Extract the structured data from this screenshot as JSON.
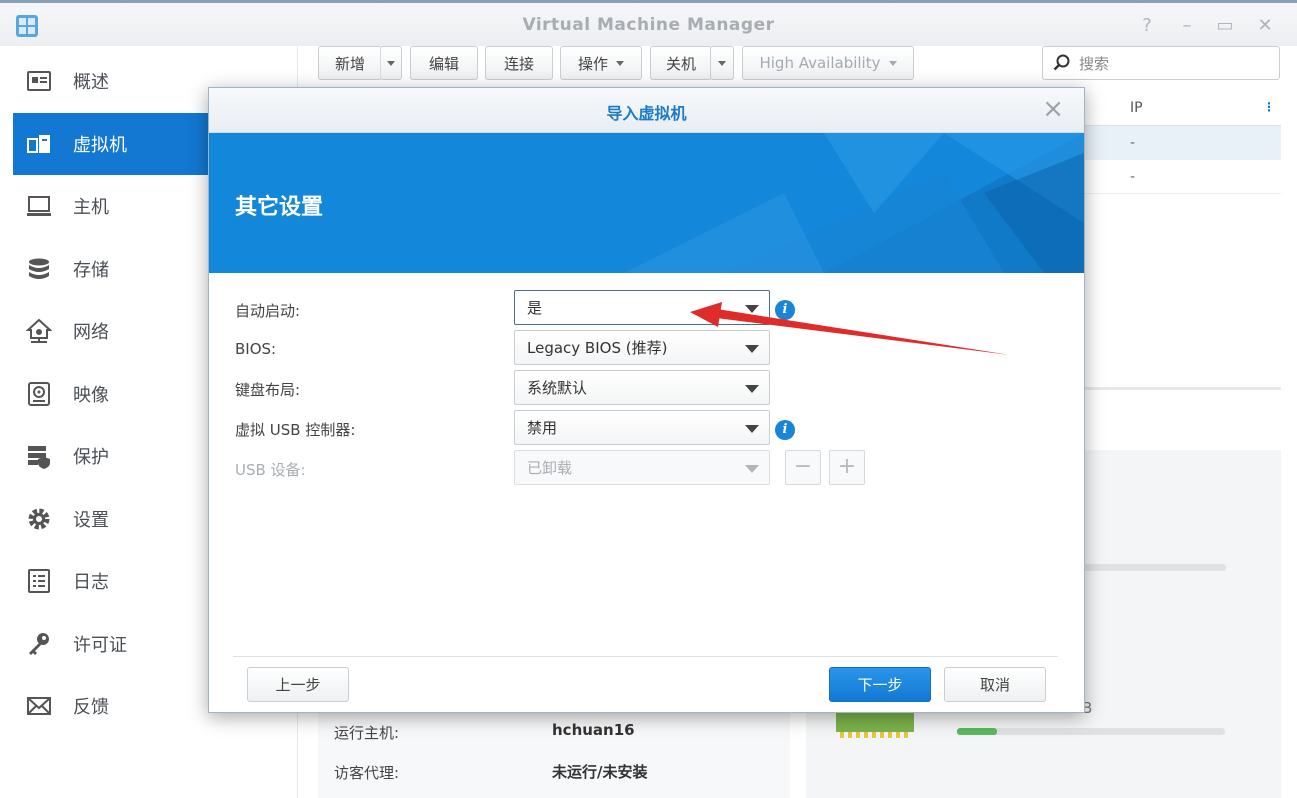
{
  "window": {
    "title": "Virtual Machine Manager",
    "controls": [
      "help-icon",
      "minimize-icon",
      "maximize-icon",
      "close-icon"
    ]
  },
  "sidebar": {
    "items": [
      {
        "label": "概述",
        "icon": "overview-icon",
        "active": false
      },
      {
        "label": "虚拟机",
        "icon": "virtual-machine-icon",
        "active": true
      },
      {
        "label": "主机",
        "icon": "host-icon",
        "active": false
      },
      {
        "label": "存储",
        "icon": "storage-icon",
        "active": false
      },
      {
        "label": "网络",
        "icon": "network-icon",
        "active": false
      },
      {
        "label": "映像",
        "icon": "image-icon",
        "active": false
      },
      {
        "label": "保护",
        "icon": "protection-icon",
        "active": false
      },
      {
        "label": "设置",
        "icon": "settings-icon",
        "active": false
      },
      {
        "label": "日志",
        "icon": "log-icon",
        "active": false
      },
      {
        "label": "许可证",
        "icon": "license-icon",
        "active": false
      },
      {
        "label": "反馈",
        "icon": "feedback-icon",
        "active": false
      }
    ]
  },
  "toolbar": {
    "add": "新增",
    "edit": "编辑",
    "connect": "连接",
    "action": "操作",
    "shutdown": "关机",
    "ha": "High Availability",
    "search_placeholder": "搜索"
  },
  "background": {
    "ip_header": "IP",
    "rows": [
      "-",
      "-"
    ],
    "host_label": "运行主机:",
    "host_value": "hchuan16",
    "agent_label": "访客代理:",
    "agent_value": "未运行/未安装",
    "unit_fragment": "B",
    "usage_fraction": 0.15
  },
  "dialog": {
    "title": "导入虚拟机",
    "section_title": "其它设置",
    "fields": {
      "autostart": {
        "label": "自动启动:",
        "value": "是"
      },
      "bios": {
        "label": "BIOS:",
        "value": "Legacy BIOS (推荐)"
      },
      "keyboard": {
        "label": "键盘布局:",
        "value": "系统默认"
      },
      "usb_controller": {
        "label": "虚拟 USB 控制器:",
        "value": "禁用"
      },
      "usb_device": {
        "label": "USB 设备:",
        "value": "已卸载"
      }
    },
    "buttons": {
      "back": "上一步",
      "next": "下一步",
      "cancel": "取消"
    }
  },
  "colors": {
    "accent": "#1378d1",
    "annotation_arrow": "#e02b2b"
  }
}
